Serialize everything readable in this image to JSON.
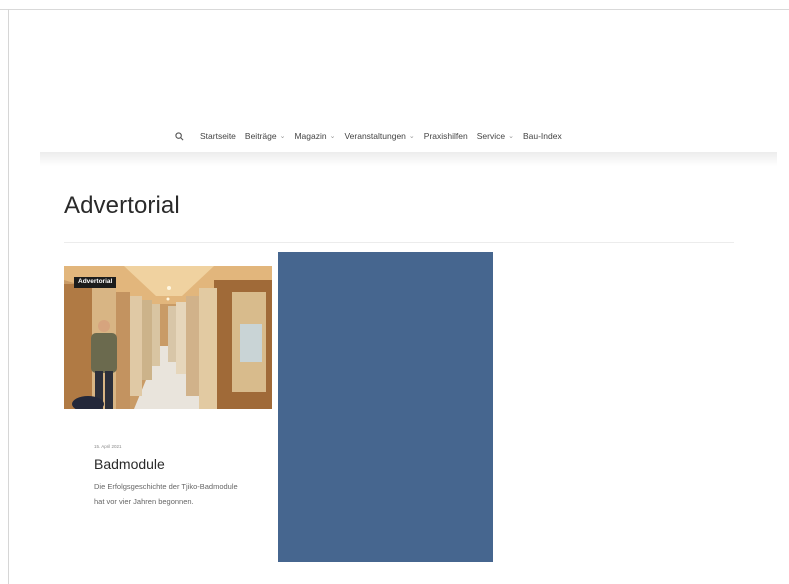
{
  "nav": {
    "items": [
      {
        "label": "Startseite",
        "dropdown": false
      },
      {
        "label": "Beiträge",
        "dropdown": true
      },
      {
        "label": "Magazin",
        "dropdown": true
      },
      {
        "label": "Veranstaltungen",
        "dropdown": true
      },
      {
        "label": "Praxishilfen",
        "dropdown": false
      },
      {
        "label": "Service",
        "dropdown": true
      },
      {
        "label": "Bau-Index",
        "dropdown": false
      }
    ],
    "search_icon": "search-icon"
  },
  "page": {
    "title": "Advertorial"
  },
  "card": {
    "badge": "Advertorial",
    "date": "15. April 2021",
    "title": "Badmodule",
    "excerpt": "Die Erfolgsgeschichte der Tjiko-Badmodule hat vor vier Jahren begonnen."
  },
  "colors": {
    "ad_block": "#46668f",
    "badge_bg": "#1c1c1c"
  }
}
